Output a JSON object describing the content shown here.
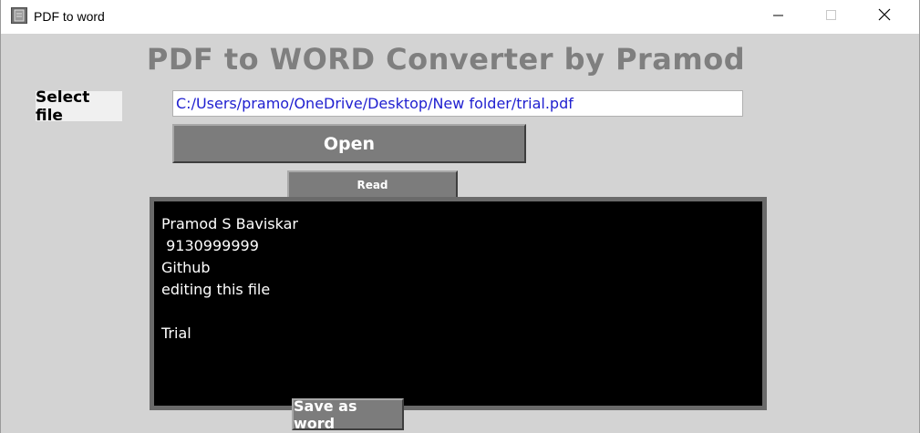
{
  "window": {
    "title": "PDF to word",
    "icon": "app-window-icon",
    "controls": {
      "minimize_icon": "minimize-icon",
      "maximize_icon": "maximize-icon",
      "close_icon": "close-icon"
    }
  },
  "main": {
    "heading": "PDF to WORD Converter by Pramod",
    "select_file_label": "Select file",
    "file_path_value": "C:/Users/pramo/OneDrive/Desktop/New folder/trial.pdf",
    "open_button_label": "Open",
    "read_button_label": "Read",
    "text_content": "Pramod S Baviskar\n 9130999999\nGithub\nediting this file\n\nTrial",
    "save_button_label": "Save as word"
  },
  "colors": {
    "background": "#d3d3d3",
    "heading": "#7f7f7f",
    "button": "#7c7c7c",
    "path_text": "#2020d0",
    "text_area_bg": "#000000",
    "text_area_fg": "#ffffff"
  }
}
